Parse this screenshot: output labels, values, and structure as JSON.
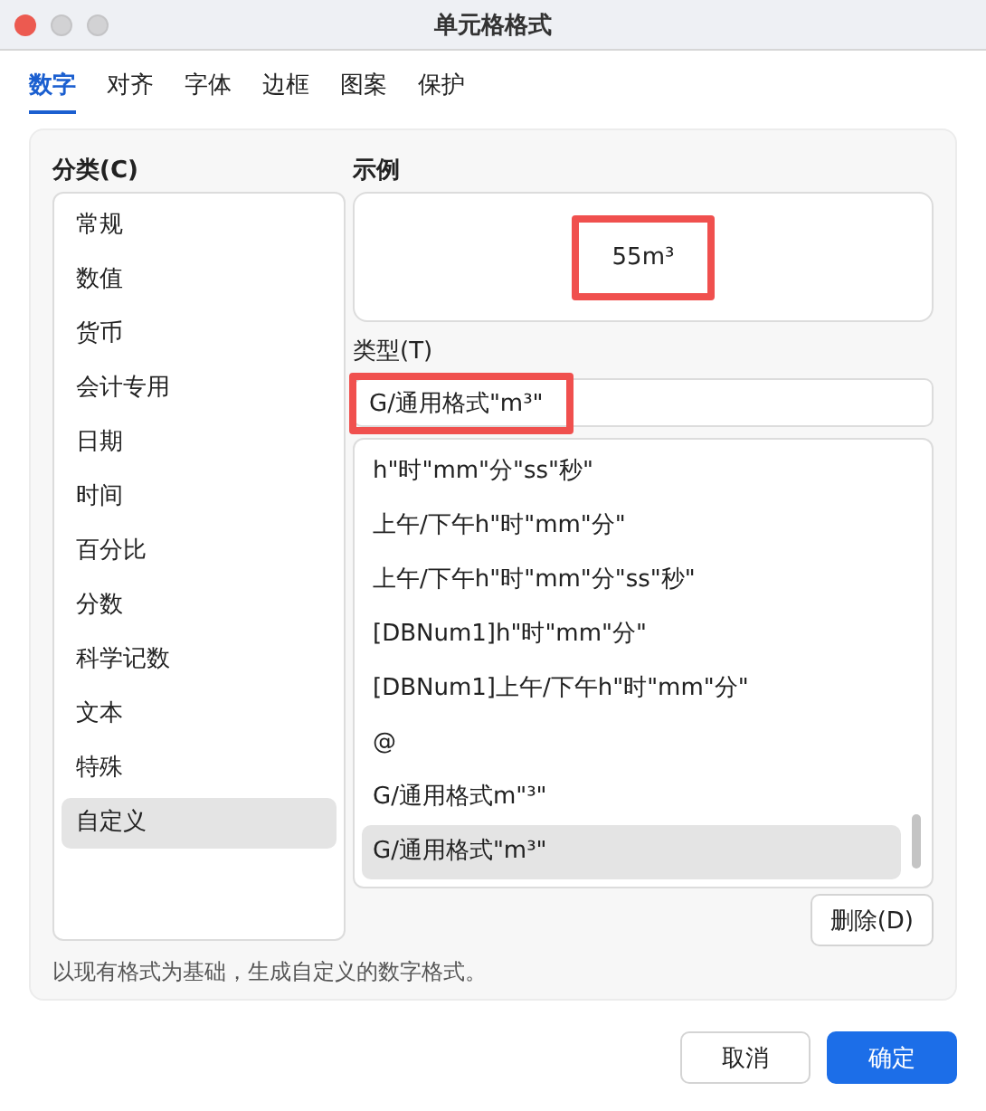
{
  "window": {
    "title": "单元格格式"
  },
  "tabs": [
    {
      "label": "数字",
      "selected": true
    },
    {
      "label": "对齐",
      "selected": false
    },
    {
      "label": "字体",
      "selected": false
    },
    {
      "label": "边框",
      "selected": false
    },
    {
      "label": "图案",
      "selected": false
    },
    {
      "label": "保护",
      "selected": false
    }
  ],
  "category": {
    "label": "分类(C)",
    "items": [
      {
        "label": "常规",
        "selected": false
      },
      {
        "label": "数值",
        "selected": false
      },
      {
        "label": "货币",
        "selected": false
      },
      {
        "label": "会计专用",
        "selected": false
      },
      {
        "label": "日期",
        "selected": false
      },
      {
        "label": "时间",
        "selected": false
      },
      {
        "label": "百分比",
        "selected": false
      },
      {
        "label": "分数",
        "selected": false
      },
      {
        "label": "科学记数",
        "selected": false
      },
      {
        "label": "文本",
        "selected": false
      },
      {
        "label": "特殊",
        "selected": false
      },
      {
        "label": "自定义",
        "selected": true
      }
    ]
  },
  "sample": {
    "label": "示例",
    "value": "55m³",
    "highlighted": true
  },
  "type": {
    "label": "类型(T)",
    "value": "G/通用格式\"m³\"",
    "highlighted": true,
    "items": [
      {
        "label": "h\"时\"mm\"分\"ss\"秒\"",
        "selected": false
      },
      {
        "label": "上午/下午h\"时\"mm\"分\"",
        "selected": false
      },
      {
        "label": "上午/下午h\"时\"mm\"分\"ss\"秒\"",
        "selected": false
      },
      {
        "label": "[DBNum1]h\"时\"mm\"分\"",
        "selected": false
      },
      {
        "label": "[DBNum1]上午/下午h\"时\"mm\"分\"",
        "selected": false
      },
      {
        "label": "@",
        "selected": false
      },
      {
        "label": "G/通用格式m\"³\"",
        "selected": false
      },
      {
        "label": "G/通用格式\"m³\"",
        "selected": true
      }
    ]
  },
  "delete_button": "删除(D)",
  "description": "以现有格式为基础，生成自定义的数字格式。",
  "buttons": [
    {
      "label": "取消",
      "kind": "secondary"
    },
    {
      "label": "确定",
      "kind": "primary"
    }
  ]
}
